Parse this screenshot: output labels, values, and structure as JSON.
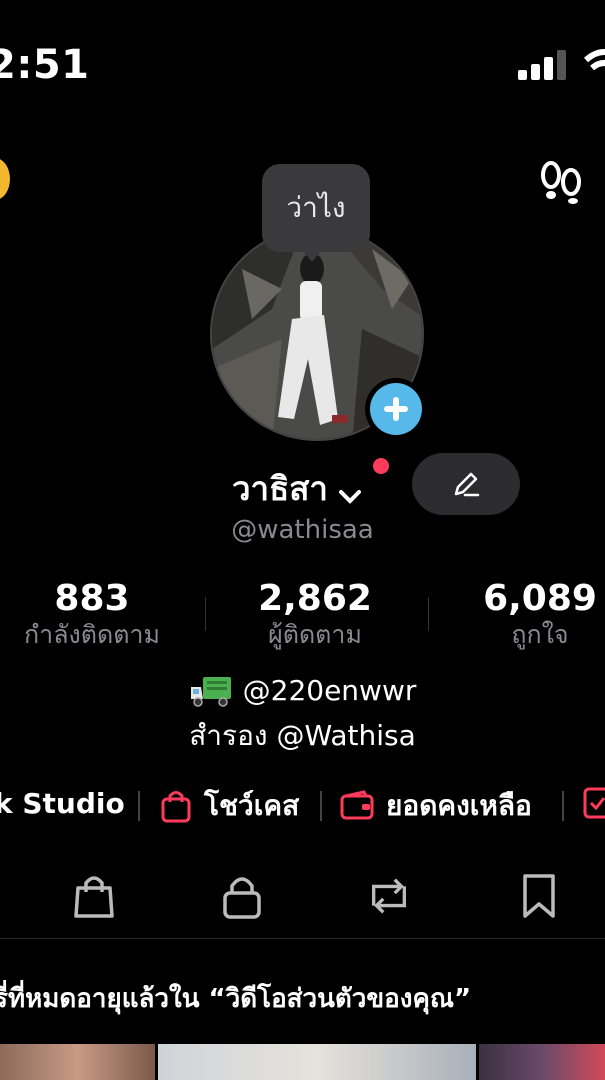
{
  "status_bar": {
    "time": "2:51"
  },
  "header": {
    "coin_icon": "coin-icon",
    "right_icon": "footprints-icon"
  },
  "profile": {
    "status_bubble": "ว่าไง",
    "display_name": "วาธิสา",
    "username": "@wathisaa",
    "avatar_icon": "avatar",
    "add_icon": "plus-icon",
    "edit_icon": "pencil-icon"
  },
  "stats": {
    "following": {
      "value": "883",
      "label": "กำลังติดตาม"
    },
    "followers": {
      "value": "2,862",
      "label": "ผู้ติดตาม"
    },
    "likes": {
      "value": "6,089",
      "label": "ถูกใจ"
    }
  },
  "bio": {
    "line1": "@220enwwr",
    "line2": "สำรอง @Wathisa"
  },
  "links": {
    "studio": "k Studio",
    "showcase": "โชว์เคส",
    "balance": "ยอดคงเหลือ"
  },
  "tabs": [
    "shopping-bag-icon",
    "lock-icon",
    "repost-icon",
    "bookmark-icon"
  ],
  "notice": "รี่ที่หมดอายุแล้วใน “วิดีโอส่วนตัวของคุณ”",
  "colors": {
    "accent_red": "#ff3b5c",
    "plus_blue": "#57b8ea",
    "muted": "#8a8a8e"
  }
}
